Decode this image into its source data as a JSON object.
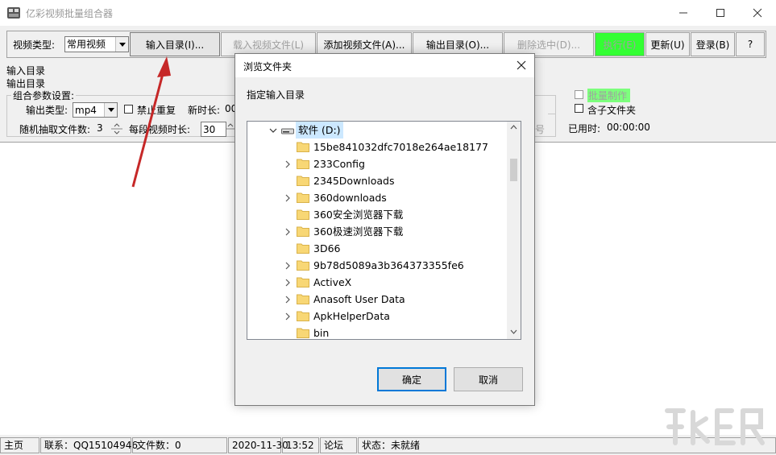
{
  "app": {
    "title": "亿彩视频批量组合器"
  },
  "toolbar": {
    "video_type_label": "视频类型:",
    "video_type_value": "常用视频",
    "input_dir": "输入目录(I)...",
    "load_video": "载入视频文件(L)",
    "add_video": "添加视频文件(A)...",
    "output_dir": "输出目录(O)...",
    "delete_selected": "删除选中(D)...",
    "execute": "执行(E)",
    "update": "更新(U)",
    "login": "登录(B)",
    "help": "?"
  },
  "paths": {
    "input_label": "输入目录",
    "output_label": "输出目录"
  },
  "params": {
    "group_title": "组合参数设置:",
    "output_type_label": "输出类型:",
    "output_type_value": "mp4",
    "no_repeat_label": "禁止重复",
    "new_duration_label": "新时长:",
    "new_duration_value": "00",
    "random_files_label": "随机抽取文件数:",
    "random_files_value": "3",
    "segment_duration_label": "每段视频时长:",
    "segment_duration_value": "30",
    "batch_label": "批量制作",
    "subfolder_label": "含子文件夹",
    "hidden_tail": "号",
    "elapsed_label": "已用时:",
    "elapsed_value": "00:00:00"
  },
  "dialog": {
    "title": "浏览文件夹",
    "prompt": "指定输入目录",
    "drive": "软件 (D:)",
    "folders": [
      {
        "name": "15be841032dfc7018e264ae18177",
        "expandable": false
      },
      {
        "name": "233Config",
        "expandable": true
      },
      {
        "name": "2345Downloads",
        "expandable": false
      },
      {
        "name": "360downloads",
        "expandable": true
      },
      {
        "name": "360安全浏览器下载",
        "expandable": false
      },
      {
        "name": "360极速浏览器下载",
        "expandable": true
      },
      {
        "name": "3D66",
        "expandable": false
      },
      {
        "name": "9b78d5089a3b364373355fe6",
        "expandable": true
      },
      {
        "name": "ActiveX",
        "expandable": true
      },
      {
        "name": "Anasoft User Data",
        "expandable": true
      },
      {
        "name": "ApkHelperData",
        "expandable": true
      },
      {
        "name": "bin",
        "expandable": false
      }
    ],
    "ok": "确定",
    "cancel": "取消"
  },
  "status": {
    "home": "主页",
    "contact": "联系：QQ15104946",
    "file_count": "文件数：0",
    "date": "2020-11-30",
    "time": "13:52",
    "forum": "论坛",
    "state": "状态：未就绪"
  },
  "colors": {
    "execute_bg": "#33ff33",
    "batch_highlight": "#7dff7d",
    "selection": "#cce8ff",
    "folder": "#f8d775",
    "arrow": "#c62828",
    "dialog_accent": "#0078d7"
  },
  "icons": {
    "app": "app-logo-icon",
    "drive": "drive-icon",
    "folder": "folder-icon"
  }
}
